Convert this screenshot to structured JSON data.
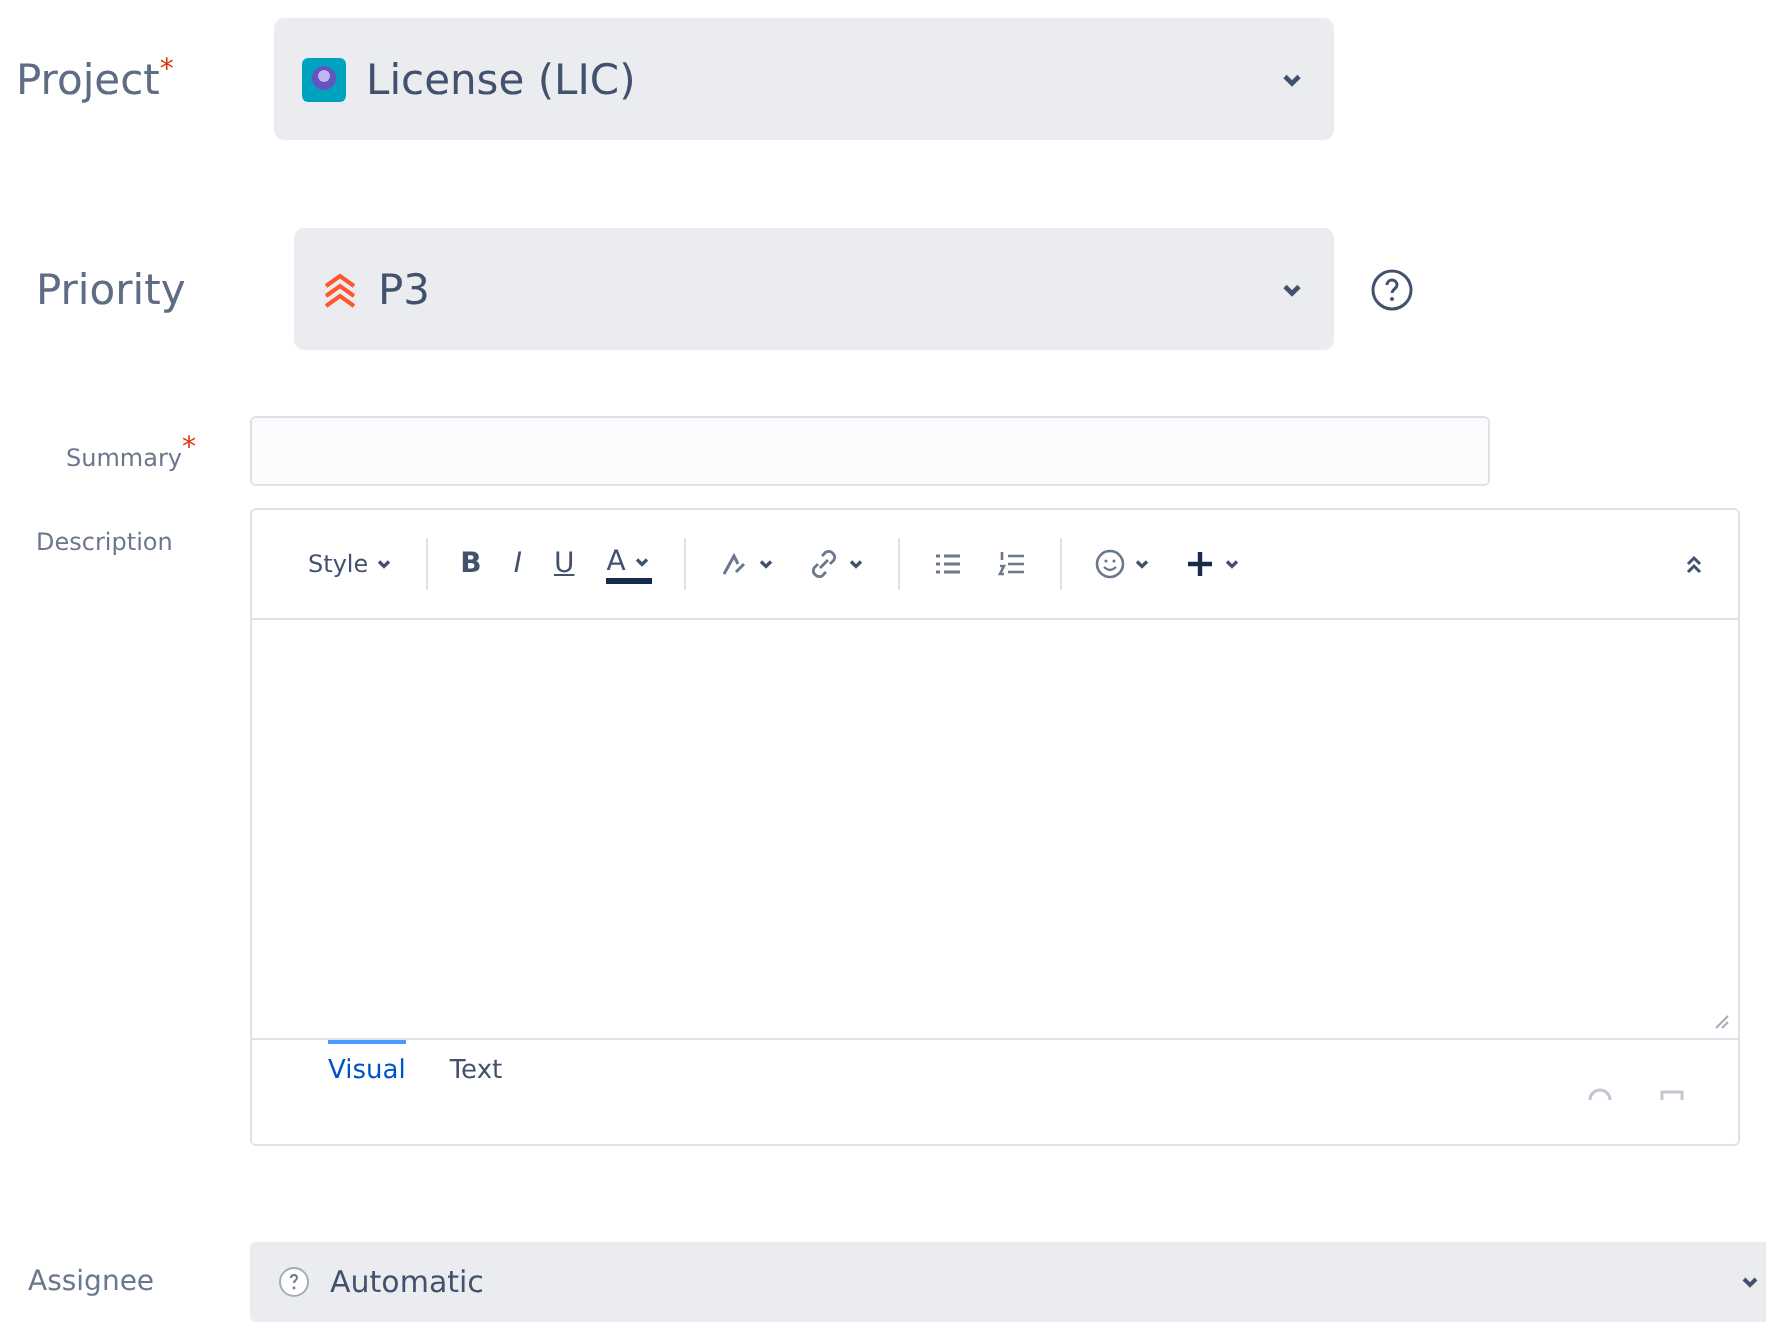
{
  "project": {
    "label": "Project",
    "required_mark": "*",
    "value": "License (LIC)"
  },
  "priority": {
    "label": "Priority",
    "value": "P3"
  },
  "summary": {
    "label": "Summary",
    "required_mark": "*"
  },
  "description": {
    "label": "Description",
    "toolbar": [
      {
        "kind": "text",
        "label": "Style",
        "caret": true
      },
      {
        "kind": "text",
        "label": "B",
        "caret": false
      },
      {
        "kind": "text",
        "label": "I",
        "caret": false
      },
      {
        "kind": "text",
        "label": "U",
        "caret": false
      },
      {
        "kind": "text",
        "label": "A",
        "caret": true
      },
      {
        "kind": "icon",
        "caret": true
      },
      {
        "kind": "icon",
        "caret": true
      },
      {
        "kind": "icon",
        "caret": false
      },
      {
        "kind": "icon",
        "caret": false
      },
      {
        "kind": "icon",
        "caret": true
      },
      {
        "kind": "icon",
        "caret": true
      }
    ],
    "tabs": [
      {
        "label": "Visual",
        "selected": true
      },
      {
        "label": "Text",
        "selected": false
      }
    ]
  },
  "assignee": {
    "label": "Assignee",
    "value": "Automatic"
  }
}
